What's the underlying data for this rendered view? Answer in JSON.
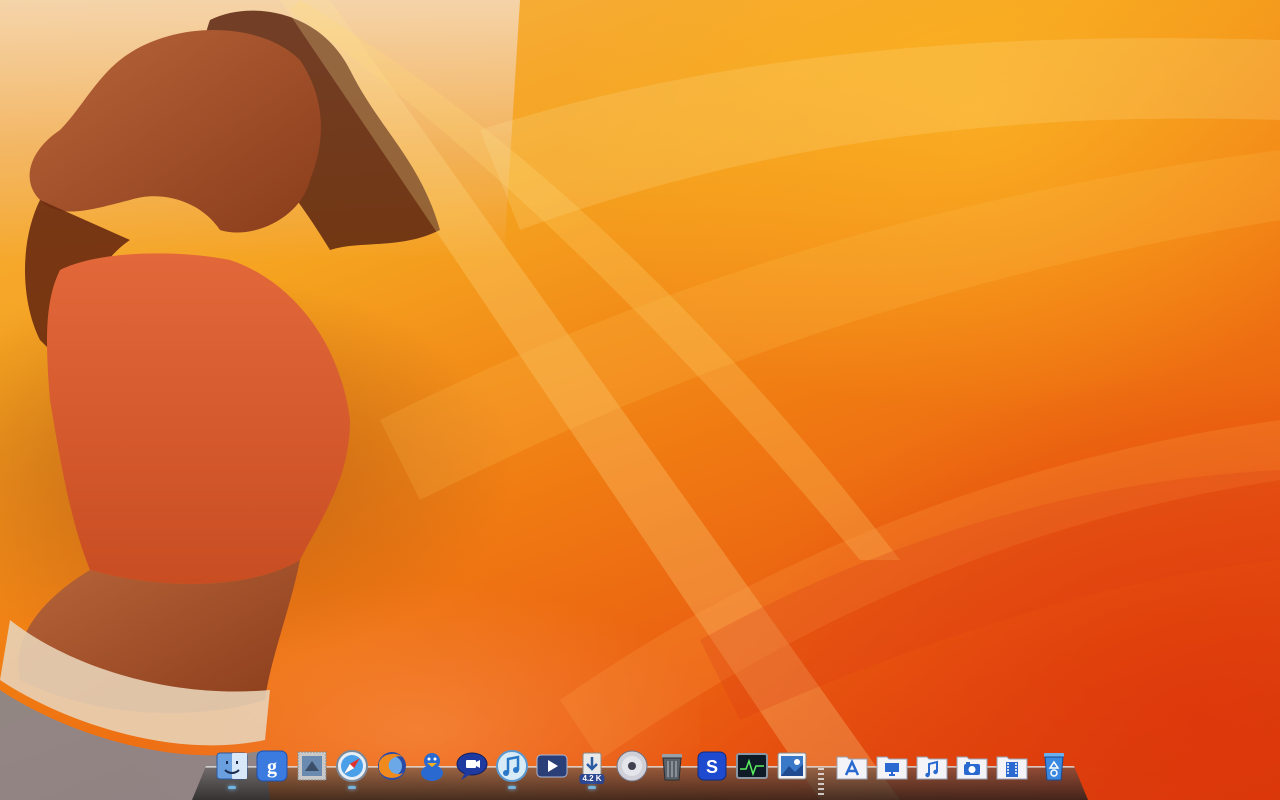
{
  "desktop": {
    "wallpaper": "photo-wallpaper",
    "colors": {
      "primary": "#f59a1c",
      "deep": "#d83c0c",
      "light": "#f9c465"
    }
  },
  "dock": {
    "apps": [
      {
        "id": "finder",
        "icon": "finder-icon"
      },
      {
        "id": "google",
        "icon": "google-icon"
      },
      {
        "id": "mail",
        "icon": "mail-stamp-icon"
      },
      {
        "id": "safari",
        "icon": "safari-compass-icon"
      },
      {
        "id": "firefox",
        "icon": "firefox-icon"
      },
      {
        "id": "adium",
        "icon": "adium-duck-icon"
      },
      {
        "id": "ichat",
        "icon": "ichat-bubble-icon"
      },
      {
        "id": "itunes",
        "icon": "itunes-icon"
      },
      {
        "id": "front-row",
        "icon": "front-row-play-icon"
      },
      {
        "id": "transmission",
        "icon": "download-icon",
        "badge": "4.2 K"
      },
      {
        "id": "dvd-player",
        "icon": "dvd-disc-icon"
      },
      {
        "id": "trash-app",
        "icon": "trash-can-icon"
      },
      {
        "id": "skype",
        "icon": "skype-icon"
      },
      {
        "id": "activity-monitor",
        "icon": "activity-monitor-icon"
      },
      {
        "id": "iphoto",
        "icon": "iphoto-icon"
      }
    ],
    "folders": [
      {
        "id": "applications",
        "icon": "applications-folder-icon"
      },
      {
        "id": "desktop",
        "icon": "desktop-folder-icon"
      },
      {
        "id": "music",
        "icon": "music-folder-icon"
      },
      {
        "id": "pictures",
        "icon": "pictures-folder-icon"
      },
      {
        "id": "movies",
        "icon": "movies-folder-icon"
      }
    ],
    "trash": {
      "id": "trash",
      "icon": "recycle-bin-icon"
    }
  }
}
